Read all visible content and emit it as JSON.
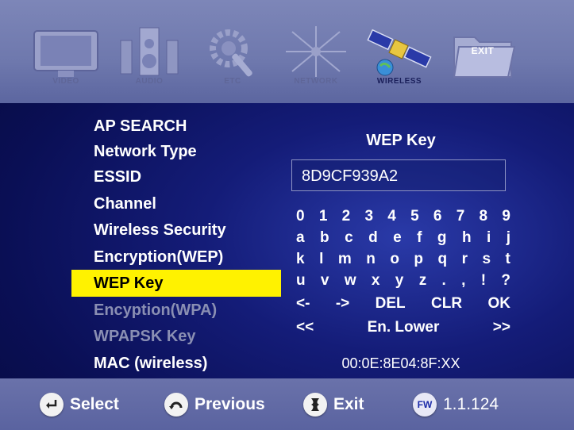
{
  "topbar": {
    "items": [
      {
        "label": "VIDEO",
        "icon": "tv-icon",
        "active": false
      },
      {
        "label": "AUDIO",
        "icon": "speaker-icon",
        "active": false
      },
      {
        "label": "ETC",
        "icon": "gear-wrench-icon",
        "active": false
      },
      {
        "label": "NETWORK",
        "icon": "network-icon",
        "active": false
      },
      {
        "label": "WIRELESS",
        "icon": "satellite-icon",
        "active": true
      },
      {
        "label": "EXIT",
        "icon": "exit-folder-icon",
        "active": false
      }
    ]
  },
  "menu": {
    "items": [
      {
        "label": "AP SEARCH",
        "state": "normal"
      },
      {
        "label": "Network Type",
        "state": "normal"
      },
      {
        "label": "ESSID",
        "state": "normal"
      },
      {
        "label": "Channel",
        "state": "normal"
      },
      {
        "label": "Wireless Security",
        "state": "normal"
      },
      {
        "label": "Encryption(WEP)",
        "state": "normal"
      },
      {
        "label": "WEP Key",
        "state": "selected"
      },
      {
        "label": "Encyption(WPA)",
        "state": "disabled"
      },
      {
        "label": "WPAPSK Key",
        "state": "disabled"
      },
      {
        "label": "MAC (wireless)",
        "state": "normal"
      }
    ]
  },
  "keypanel": {
    "title": "WEP Key",
    "value": "8D9CF939A2",
    "keyboard": [
      [
        "0",
        "1",
        "2",
        "3",
        "4",
        "5",
        "6",
        "7",
        "8",
        "9"
      ],
      [
        "a",
        "b",
        "c",
        "d",
        "e",
        "f",
        "g",
        "h",
        "i",
        "j"
      ],
      [
        "k",
        "l",
        "m",
        "n",
        "o",
        "p",
        "q",
        "r",
        "s",
        "t"
      ],
      [
        "u",
        "v",
        "w",
        "x",
        "y",
        "z",
        ".",
        ",",
        "!",
        "?"
      ],
      [
        "<-",
        "->",
        "DEL",
        "CLR",
        "OK"
      ],
      [
        "<<",
        "En. Lower",
        ">>"
      ]
    ],
    "mac": "00:0E:8E04:8F:XX"
  },
  "bottombar": {
    "select_label": "Select",
    "previous_label": "Previous",
    "exit_label": "Exit",
    "fw_badge": "FW",
    "fw_version": "1.1.124"
  },
  "colors": {
    "highlight": "#fff200",
    "background": "#141c78",
    "bar": "#6e78ad"
  }
}
